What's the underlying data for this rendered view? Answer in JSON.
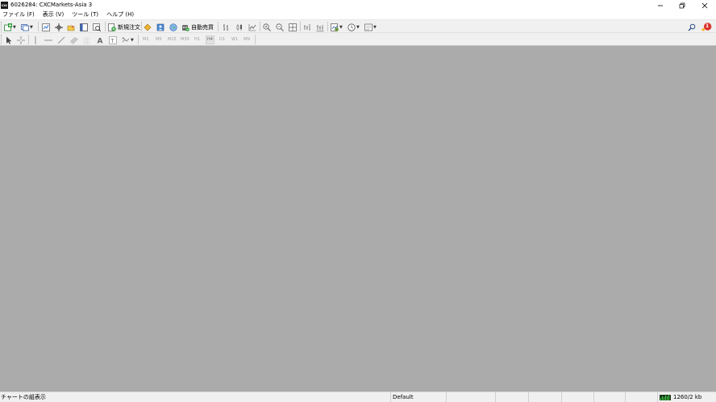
{
  "window": {
    "title": "6026284: CXCMarkets-Asia 3",
    "app_icon": "mt4-icon",
    "controls": [
      "minimize-icon",
      "restore-icon",
      "close-icon"
    ]
  },
  "menu": {
    "items": [
      {
        "label": "ファイル (F)"
      },
      {
        "label": "表示 (V)"
      },
      {
        "label": "ツール (T)"
      },
      {
        "label": "ヘルプ (H)"
      }
    ]
  },
  "toolbar": {
    "new_order_label": "新規注文",
    "auto_trade_label": "自動売買",
    "alert_count": "1"
  },
  "timeframes": [
    {
      "label": "M1",
      "active": false
    },
    {
      "label": "M5",
      "active": false
    },
    {
      "label": "M15",
      "active": false
    },
    {
      "label": "M30",
      "active": false
    },
    {
      "label": "H1",
      "active": false
    },
    {
      "label": "H4",
      "active": true
    },
    {
      "label": "D1",
      "active": false
    },
    {
      "label": "W1",
      "active": false
    },
    {
      "label": "MN",
      "active": false
    }
  ],
  "statusbar": {
    "status_text": "チャートの組表示",
    "profile": "Default",
    "traffic": "1260/2 kb"
  },
  "colors": {
    "workspace": "#ababab",
    "toolbar": "#f0f0f0",
    "accent_green": "#2e9e3a",
    "alert_red": "#d9342b"
  }
}
